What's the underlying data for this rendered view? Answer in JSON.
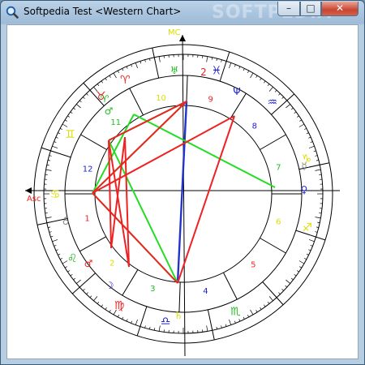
{
  "window": {
    "title": "Softpedia Test <Western Chart>",
    "watermark": "SOFTPEDIA",
    "minimize_glyph": "–",
    "maximize_glyph": "□",
    "close_glyph": "✕"
  },
  "colors": {
    "trine": "#22dd22",
    "square": "#ee2222",
    "conjunction": "#2233cc",
    "quincunx": "#cc44cc",
    "fire": "#ee2222",
    "air": "#dddd00",
    "earth": "#22bb22",
    "water": "#2222cc",
    "angle": "#000000",
    "planet": "#2233bb"
  },
  "chart": {
    "angles": {
      "asc": "Asc",
      "mc": "MC"
    },
    "signs": [
      {
        "glyph": "♈",
        "color": "#ee2222",
        "name": "aries"
      },
      {
        "glyph": "♓",
        "color": "#2222cc",
        "name": "pisces"
      },
      {
        "glyph": "♒",
        "color": "#2222cc",
        "name": "aquarius"
      },
      {
        "glyph": "♑",
        "color": "#dddd00",
        "name": "capricorn"
      },
      {
        "glyph": "♐",
        "color": "#dddd00",
        "name": "sagittarius"
      },
      {
        "glyph": "♏",
        "color": "#22bb22",
        "name": "scorpio"
      },
      {
        "glyph": "♎",
        "color": "#2222cc",
        "name": "libra"
      },
      {
        "glyph": "♍",
        "color": "#ee2222",
        "name": "virgo"
      },
      {
        "glyph": "♌",
        "color": "#22bb22",
        "name": "leo"
      },
      {
        "glyph": "♋",
        "color": "#dddd00",
        "name": "cancer"
      },
      {
        "glyph": "♊",
        "color": "#dddd00",
        "name": "gemini"
      },
      {
        "glyph": "♉",
        "color": "#dd2222",
        "name": "taurus"
      }
    ],
    "houses": [
      {
        "num": "1",
        "color": "#ee2222"
      },
      {
        "num": "2",
        "color": "#dddd00"
      },
      {
        "num": "3",
        "color": "#22bb22"
      },
      {
        "num": "4",
        "color": "#2222cc"
      },
      {
        "num": "5",
        "color": "#ee2222"
      },
      {
        "num": "6",
        "color": "#dddd00"
      },
      {
        "num": "7",
        "color": "#22bb22"
      },
      {
        "num": "8",
        "color": "#2222cc"
      },
      {
        "num": "9",
        "color": "#ee2222"
      },
      {
        "num": "10",
        "color": "#dddd00"
      },
      {
        "num": "11",
        "color": "#22bb22"
      },
      {
        "num": "12",
        "color": "#2222cc"
      }
    ],
    "planets": [
      {
        "glyph": "♅",
        "color": "#22bb22",
        "name": "uranus"
      },
      {
        "glyph": "2",
        "color": "#ee2222",
        "name": "planet-number"
      },
      {
        "glyph": "Ψ",
        "color": "#2222cc",
        "name": "neptune"
      },
      {
        "glyph": "♈",
        "color": "#22bb22",
        "name": "aries-planet"
      },
      {
        "glyph": "♂",
        "color": "#22bb22",
        "name": "mars"
      },
      {
        "glyph": "☿",
        "color": "#888888",
        "name": "mercury"
      },
      {
        "glyph": "♀",
        "color": "#2222cc",
        "name": "venus"
      },
      {
        "glyph": "♁",
        "color": "#888888",
        "name": "earth"
      },
      {
        "glyph": "♂",
        "color": "#ee2222",
        "name": "mars-2"
      },
      {
        "glyph": "☽",
        "color": "#2222cc",
        "name": "moon"
      },
      {
        "glyph": "♄",
        "color": "#dddd00",
        "name": "saturn"
      }
    ]
  }
}
